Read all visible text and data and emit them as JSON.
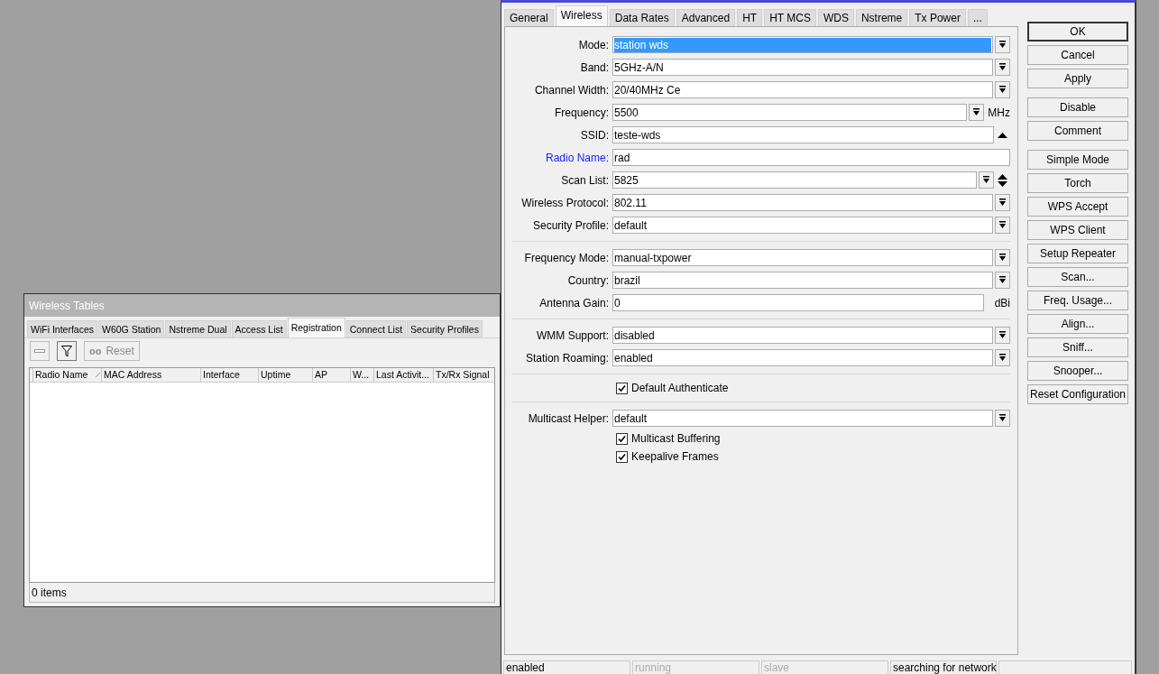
{
  "tables_window": {
    "title": "Wireless Tables",
    "tabs": [
      {
        "label": "WiFi Interfaces",
        "selected": false
      },
      {
        "label": "W60G Station",
        "selected": false
      },
      {
        "label": "Nstreme Dual",
        "selected": false
      },
      {
        "label": "Access List",
        "selected": false
      },
      {
        "label": "Registration",
        "selected": true
      },
      {
        "label": "Connect List",
        "selected": false
      },
      {
        "label": "Security Profiles",
        "selected": false
      }
    ],
    "toolbar": {
      "reset": {
        "icon_text": "oo",
        "label": "Reset",
        "disabled": true
      }
    },
    "columns": [
      {
        "label": "Radio Name",
        "sorted": true
      },
      {
        "label": "MAC Address",
        "sorted": false
      },
      {
        "label": "Interface",
        "sorted": false
      },
      {
        "label": "Uptime",
        "sorted": false
      },
      {
        "label": "AP",
        "sorted": false
      },
      {
        "label": "W...",
        "sorted": false
      },
      {
        "label": "Last Activit...",
        "sorted": false
      },
      {
        "label": "Tx/Rx Signal",
        "sorted": false
      }
    ],
    "footer": "0 items"
  },
  "interface_window": {
    "tabs": [
      {
        "label": "General",
        "selected": false
      },
      {
        "label": "Wireless",
        "selected": true
      },
      {
        "label": "Data Rates",
        "selected": false
      },
      {
        "label": "Advanced",
        "selected": false
      },
      {
        "label": "HT",
        "selected": false
      },
      {
        "label": "HT MCS",
        "selected": false
      },
      {
        "label": "WDS",
        "selected": false
      },
      {
        "label": "Nstreme",
        "selected": false
      },
      {
        "label": "Tx Power",
        "selected": false
      },
      {
        "label": "...",
        "selected": false
      }
    ],
    "sections": [
      {
        "rows": [
          {
            "kind": "select",
            "label": "Mode:",
            "value": "station wds",
            "highlighted": true,
            "accent": false
          },
          {
            "kind": "select",
            "label": "Band:",
            "value": "5GHz-A/N",
            "highlighted": false,
            "accent": false
          },
          {
            "kind": "select",
            "label": "Channel Width:",
            "value": "20/40MHz Ce",
            "highlighted": false,
            "accent": false
          },
          {
            "kind": "select",
            "label": "Frequency:",
            "value": "5500",
            "unit": "MHz",
            "highlighted": false,
            "accent": false
          },
          {
            "kind": "expandable",
            "label": "SSID:",
            "value": "teste-wds",
            "highlighted": false,
            "accent": false
          },
          {
            "kind": "text",
            "label": "Radio Name:",
            "value": "rad",
            "highlighted": false,
            "accent": true
          },
          {
            "kind": "multi",
            "label": "Scan List:",
            "value": "5825",
            "highlighted": false,
            "accent": false
          },
          {
            "kind": "select",
            "label": "Wireless Protocol:",
            "value": "802.11",
            "highlighted": false,
            "accent": false
          },
          {
            "kind": "select",
            "label": "Security Profile:",
            "value": "default",
            "highlighted": false,
            "accent": false
          }
        ]
      },
      {
        "rows": [
          {
            "kind": "select",
            "label": "Frequency Mode:",
            "value": "manual-txpower",
            "highlighted": false,
            "accent": false
          },
          {
            "kind": "select",
            "label": "Country:",
            "value": "brazil",
            "highlighted": false,
            "accent": false
          },
          {
            "kind": "text",
            "label": "Antenna Gain:",
            "value": "0",
            "unit": "dBi",
            "highlighted": false,
            "accent": false
          }
        ]
      },
      {
        "rows": [
          {
            "kind": "select",
            "label": "WMM Support:",
            "value": "disabled",
            "highlighted": false,
            "accent": false
          },
          {
            "kind": "select",
            "label": "Station Roaming:",
            "value": "enabled",
            "highlighted": false,
            "accent": false
          }
        ]
      },
      {
        "rows": [
          {
            "kind": "checkbox",
            "label": "Default Authenticate",
            "checked": true
          }
        ]
      },
      {
        "rows": [
          {
            "kind": "select",
            "label": "Multicast Helper:",
            "value": "default",
            "highlighted": false,
            "accent": false
          },
          {
            "kind": "checkbox",
            "label": "Multicast Buffering",
            "checked": true
          },
          {
            "kind": "checkbox",
            "label": "Keepalive Frames",
            "checked": true
          }
        ]
      }
    ],
    "button_groups": [
      [
        {
          "label": "OK",
          "default": true
        },
        {
          "label": "Cancel",
          "default": false
        },
        {
          "label": "Apply",
          "default": false
        }
      ],
      [
        {
          "label": "Disable",
          "default": false
        },
        {
          "label": "Comment",
          "default": false
        }
      ],
      [
        {
          "label": "Simple Mode",
          "default": false
        },
        {
          "label": "Torch",
          "default": false
        },
        {
          "label": "WPS Accept",
          "default": false
        },
        {
          "label": "WPS Client",
          "default": false
        },
        {
          "label": "Setup Repeater",
          "default": false
        },
        {
          "label": "Scan...",
          "default": false
        },
        {
          "label": "Freq. Usage...",
          "default": false
        },
        {
          "label": "Align...",
          "default": false
        },
        {
          "label": "Sniff...",
          "default": false
        },
        {
          "label": "Snooper...",
          "default": false
        },
        {
          "label": "Reset Configuration",
          "default": false
        }
      ]
    ],
    "status_bar": [
      {
        "text": "enabled",
        "disabled": false
      },
      {
        "text": "running",
        "disabled": true
      },
      {
        "text": "slave",
        "disabled": true
      },
      {
        "text": "searching for network",
        "disabled": false
      }
    ]
  }
}
